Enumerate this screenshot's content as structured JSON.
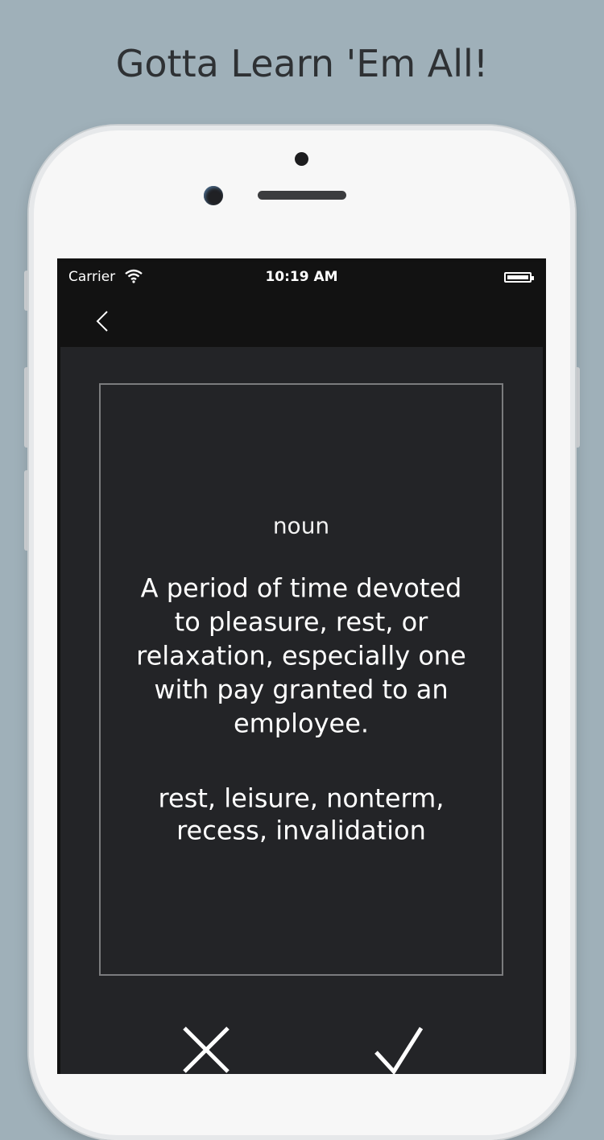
{
  "headline": "Gotta Learn 'Em All!",
  "status_bar": {
    "carrier": "Carrier",
    "time": "10:19 AM",
    "wifi_icon": "wifi-icon",
    "battery_icon": "battery-icon"
  },
  "nav": {
    "back_icon": "chevron-left-icon"
  },
  "card": {
    "part_of_speech": "noun",
    "definition": "A period of time devoted to pleasure, rest, or relaxation, especially one with pay granted to an employee.",
    "synonyms": "rest, leisure, nonterm, recess, invalidation"
  },
  "actions": {
    "wrong_icon": "close-icon",
    "right_icon": "checkmark-icon"
  },
  "colors": {
    "background": "#9fb0b9",
    "screen": "#232427",
    "bars": "#121212",
    "text": "#ffffff"
  }
}
